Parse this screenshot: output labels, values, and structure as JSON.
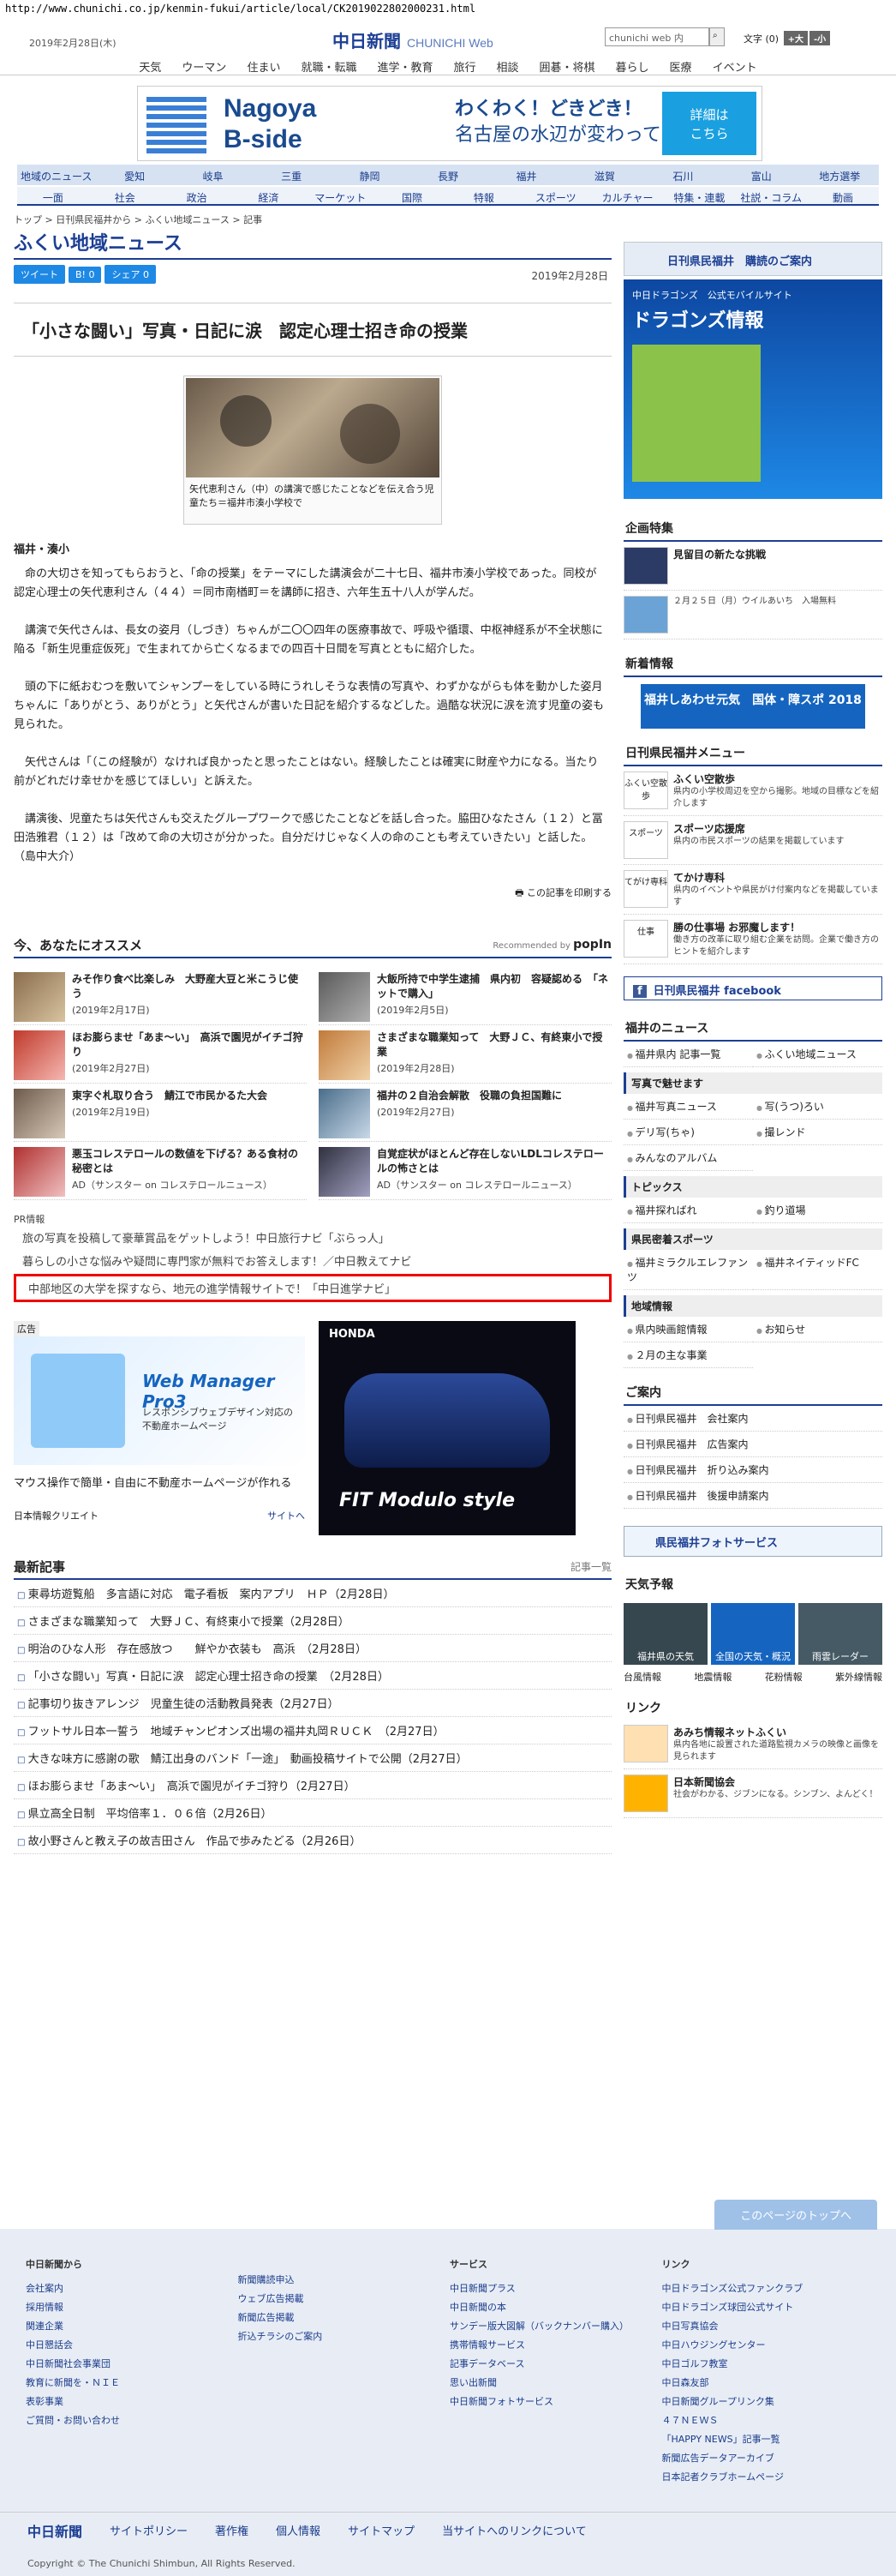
{
  "url": "http://www.chunichi.co.jp/kenmin-fukui/article/local/CK2019022802000231.html",
  "header": {
    "date": "2019年2月28日(木)",
    "logo": "中日新聞",
    "logo_sub": "CHUNICHI Web",
    "search_placeholder": "chunichi web 内",
    "text_size_label": "文字",
    "text_size_paren": "(0)",
    "text_size_large": "+大",
    "text_size_small": "-小"
  },
  "global_nav": [
    "天気",
    "ウーマン",
    "住まい",
    "就職・転職",
    "進学・教育",
    "旅行",
    "相談",
    "囲碁・将棋",
    "暮らし",
    "医療",
    "イベント"
  ],
  "banner": {
    "title_line1": "Nagoya",
    "title_line2": "B-side",
    "tagline1": "わくわく！どきどき！",
    "tagline2": "名古屋の水辺が変わっていく",
    "button_line1": "詳細は",
    "button_line2": "こちら"
  },
  "region_nav": [
    "地域のニュース",
    "愛知",
    "岐阜",
    "三重",
    "静岡",
    "長野",
    "福井",
    "滋賀",
    "石川",
    "富山",
    "地方選挙"
  ],
  "category_nav": [
    "一面",
    "社会",
    "政治",
    "経済",
    "マーケット",
    "国際",
    "特報",
    "スポーツ",
    "カルチャー",
    "特集・連載",
    "社説・コラム",
    "動画"
  ],
  "breadcrumb": "トップ > 日刊県民福井から > ふくい地域ニュース > 記事",
  "page_title": "ふくい地域ニュース",
  "share": {
    "tweet": "ツイート",
    "hatena": "B! 0",
    "facebook": "シェア 0",
    "date": "2019年2月28日"
  },
  "article": {
    "title": "「小さな闘い」写真・日記に涙　認定心理士招き命の授業",
    "photo_caption": "矢代恵利さん（中）の講演で感じたことなどを伝え合う児童たち＝福井市湊小学校で",
    "location": "福井・湊小",
    "paragraphs": [
      "命の大切さを知ってもらおうと、「命の授業」をテーマにした講演会が二十七日、福井市湊小学校であった。同校が認定心理士の矢代恵利さん（４４）＝同市南楢町＝を講師に招き、六年生五十八人が学んだ。",
      "講演で矢代さんは、長女の姿月（しづき）ちゃんが二〇〇四年の医療事故で、呼吸や循環、中枢神経系が不全状態に陥る「新生児重症仮死」で生まれてから亡くなるまでの四百十日間を写真とともに紹介した。",
      "頭の下に紙おむつを敷いてシャンプーをしている時にうれしそうな表情の写真や、わずかながらも体を動かした姿月ちゃんに「ありがとう、ありがとう」と矢代さんが書いた日記を紹介するなどした。過酷な状況に涙を流す児童の姿も見られた。",
      "矢代さんは「（この経験が）なければ良かったと思ったことはない。経験したことは確実に財産や力になる。当たり前がどれだけ幸せかを感じてほしい」と訴えた。",
      "講演後、児童たちは矢代さんも交えたグループワークで感じたことなどを話し合った。脇田ひなたさん（１２）と冨田浩雅君（１２）は「改めて命の大切さが分かった。自分だけじゃなく人の命のことも考えていきたい」と話した。　（島中大介）"
    ],
    "print_label": "この記事を印刷する"
  },
  "recommend": {
    "heading": "今、あなたにオススメ",
    "popin_prefix": "Recommended by",
    "popin_brand": "popIn",
    "items": [
      {
        "title": "みそ作り食べ比楽しみ　大野産大豆と米こうじ使う",
        "date": "(2019年2月17日)"
      },
      {
        "title": "大飯所持で中学生逮捕　県内初　容疑認める　「ネットで購入」",
        "date": "(2019年2月5日)"
      },
      {
        "title": "ほお膨らませ「あま〜い」　高浜で園児がイチゴ狩り",
        "date": "(2019年2月27日)"
      },
      {
        "title": "さまざまな職業知って　大野ＪＣ、有終東小で授業",
        "date": "(2019年2月28日)"
      },
      {
        "title": "東字ぐ札取り合う　鯖江で市民かるた大会",
        "date": "(2019年2月19日)"
      },
      {
        "title": "福井の２自治会解散　役職の負担国難に",
        "date": "(2019年2月27日)"
      },
      {
        "title": "悪玉コレステロールの数値を下げる？ある食材の秘密とは",
        "date": "AD（サンスター on コレステロールニュース）"
      },
      {
        "title": "自覚症状がほとんど存在しないLDLコレステロールの怖さとは",
        "date": "AD（サンスター on コレステロールニュース）"
      }
    ]
  },
  "pr": {
    "heading": "PR情報",
    "items": [
      "旅の写真を投稿して豪華賞品をゲットしよう！中日旅行ナビ「ぶらっ人」",
      "暮らしの小さな悩みや疑問に専門家が無料でお答えします！／中日教えてナビ",
      "中部地区の大学を探すなら、地元の進学情報サイトで！「中日進学ナビ」"
    ]
  },
  "ads": {
    "label": "広告",
    "left_title": "Web Manager Pro3",
    "left_sub": "レスポンシブウェブデザイン対応の不動産ホームページ",
    "left_text": "マウス操作で簡単・自由に不動産ホームページが作れる",
    "left_company": "日本情報クリエイト",
    "left_link": "サイトへ",
    "right_brand": "HONDA",
    "right_model": "FIT Modulo style"
  },
  "latest": {
    "heading": "最新記事",
    "more": "記事一覧",
    "items": [
      "東尋坊遊覧船　多言語に対応　電子看板　案内アプリ　ＨＰ（2月28日）",
      "さまざまな職業知って　大野ＪＣ、有終東小で授業（2月28日）",
      "明治のひな人形　存在感放つ　　鮮やか衣装も　高浜　（2月28日）",
      "「小さな闘い」写真・日記に涙　認定心理士招き命の授業　（2月28日）",
      "記事切り抜きアレンジ　児童生徒の活動教員発表（2月27日）",
      "フットサル日本一誓う　地域チャンピオンズ出場の福井丸岡ＲＵＣＫ　（2月27日）",
      "大きな味方に感謝の歌　鯖江出身のバンド「一途」　動画投稿サイトで公開（2月27日）",
      "ほお膨らませ「あま〜い」　高浜で園児がイチゴ狩り（2月27日）",
      "県立高全日制　平均倍率１．０６倍（2月26日）",
      "故小野さんと教え子の故吉田さん　作品で歩みたどる（2月26日）"
    ]
  },
  "sidebar": {
    "subscribe": "日刊県民福井　購読のご案内",
    "dragons_title": "中日ドラゴンズ　公式モバイルサイト",
    "dragons_name": "ドラゴンズ情報",
    "kikaku_heading": "企画特集",
    "kikaku_item1": "見留目の新たな挑戦",
    "kikaku_item2": "２月２５日（月）ウイルあいち　入場無料",
    "newest_heading": "新着情報",
    "newest_banner": "福井しあわせ元気　国体・障スポ 2018",
    "menu_heading": "日刊県民福井メニュー",
    "menu": [
      {
        "icon": "ふくい空散歩",
        "title": "ふくい空散歩",
        "desc": "県内の小学校周辺を空から撮影。地域の目標などを紹介します"
      },
      {
        "icon": "スポーツ",
        "title": "スポーツ応援席",
        "desc": "県内の市民スポーツの結果を掲載しています"
      },
      {
        "icon": "てがけ専科",
        "title": "てかけ専科",
        "desc": "県内のイベントや県民がけ付案内などを掲載しています"
      },
      {
        "icon": "仕事",
        "title": "勝の仕事場 お邪魔します！",
        "desc": "働き方の改革に取り組む企業を訪問。企業で働き方のヒントを紹介します"
      }
    ],
    "facebook": "日刊県民福井 facebook",
    "fnews_heading": "福井のニュース",
    "fnews": [
      "福井県内 記事一覧",
      "ふくい地域ニュース"
    ],
    "photo_sub": "写真で魅せます",
    "photo_links": [
      "福井写真ニュース",
      "写(うつ)ろい",
      "デリ写(ちゃ)",
      "撮レンド",
      "みんなのアルバム"
    ],
    "topics_sub": "トピックス",
    "topics_links": [
      "福井探ればれ",
      "釣り道場"
    ],
    "sports_sub": "県民密着スポーツ",
    "sports_links": [
      "福井ミラクルエレファンツ",
      "福井ネイティッドFC"
    ],
    "region_sub": "地域情報",
    "region_links": [
      "県内映画館情報",
      "お知らせ",
      "２月の主な事業"
    ],
    "guide_heading": "ご案内",
    "guide_links": [
      "日刊県民福井　会社案内",
      "日刊県民福井　広告案内",
      "日刊県民福井　折り込み案内",
      "日刊県民福井　後援申請案内"
    ],
    "photo_service": "県民福井フォトサービス",
    "weather_heading": "天気予報",
    "weather_tiles": [
      "福井県の天気",
      "全国の天気・概況",
      "雨雲レーダー"
    ],
    "weather_links": [
      "台風情報",
      "地震情報",
      "花粉情報",
      "紫外線情報"
    ],
    "link_heading": "リンク",
    "link1_title": "あみち情報ネットふくい",
    "link1_desc": "県内各地に設置された道路監視カメラの映像と画像を見られます",
    "link2_title": "日本新聞協会",
    "link2_desc": "社会がわかる、ジブンになる。シンブン、よんどく！"
  },
  "footer": {
    "to_top": "このページのトップへ",
    "col1_head": "中日新聞から",
    "col1": [
      "会社案内",
      "採用情報",
      "関連企業",
      "中日懇話会",
      "中日新聞社会事業団",
      "教育に新聞を・ＮＩＥ",
      "表彰事業",
      "ご質問・お問い合わせ"
    ],
    "col2": [
      "新聞購読申込",
      "ウェブ広告掲載",
      "新聞広告掲載",
      "折込チラシのご案内"
    ],
    "col3_head": "サービス",
    "col3": [
      "中日新聞プラス",
      "中日新聞の本",
      "サンデー版大図解（バックナンバー購入）",
      "携帯情報サービス",
      "記事データベース",
      "思い出新聞",
      "中日新聞フォトサービス"
    ],
    "col4_head": "リンク",
    "col4": [
      "中日ドラゴンズ公式ファンクラブ",
      "中日ドラゴンズ球団公式サイト",
      "中日写真協会",
      "中日ハウジングセンター",
      "中日ゴルフ教室",
      "中日森友部",
      "中日新聞グループリンク集",
      "４７ＮＥＷＳ",
      "「HAPPY NEWS」記事一覧",
      "新聞広告データアーカイブ",
      "日本記者クラブホームページ"
    ],
    "bar_logo": "中日新聞",
    "bar_links": [
      "サイトポリシー",
      "著作権",
      "個人情報",
      "サイトマップ",
      "当サイトへのリンクについて"
    ],
    "copyright": "Copyright © The Chunichi Shimbun, All Rights Reserved."
  }
}
